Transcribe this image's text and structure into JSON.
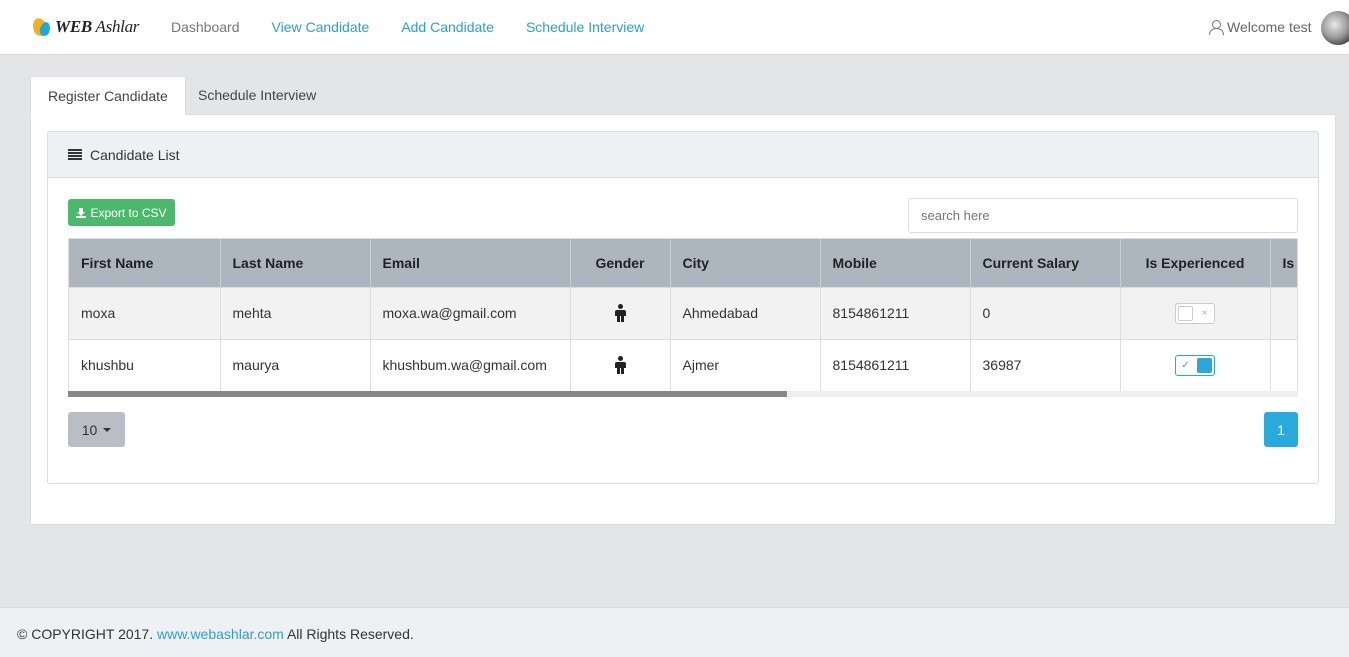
{
  "brand": {
    "logo_text_web": "WEB",
    "logo_text_rest": " Ashlar"
  },
  "nav": {
    "items": [
      {
        "label": "Dashboard"
      },
      {
        "label": "View Candidate"
      },
      {
        "label": "Add Candidate"
      },
      {
        "label": "Schedule Interview"
      }
    ]
  },
  "user": {
    "welcome": "Welcome test"
  },
  "tabs": [
    {
      "label": "Register Candidate"
    },
    {
      "label": "Schedule Interview"
    }
  ],
  "card": {
    "title": "Candidate List"
  },
  "toolbar": {
    "export_label": "Export to CSV",
    "search_placeholder": "search here"
  },
  "table": {
    "columns": [
      "First Name",
      "Last Name",
      "Email",
      "Gender",
      "City",
      "Mobile",
      "Current Salary",
      "Is Experienced",
      "Is"
    ],
    "rows": [
      {
        "first_name": "moxa",
        "last_name": "mehta",
        "email": "moxa.wa@gmail.com",
        "gender_icon": "male-icon",
        "city": "Ahmedabad",
        "mobile": "8154861211",
        "salary": "0",
        "is_experienced": false,
        "is_experienced_mark": "×"
      },
      {
        "first_name": "khushbu",
        "last_name": "maurya",
        "email": "khushbum.wa@gmail.com",
        "gender_icon": "male-icon",
        "city": "Ajmer",
        "mobile": "8154861211",
        "salary": "36987",
        "is_experienced": true,
        "is_experienced_mark": "✓"
      }
    ]
  },
  "pagination": {
    "page_size": "10",
    "current_page": "1"
  },
  "footer": {
    "copyright": "© COPYRIGHT 2017. ",
    "link": "www.webashlar.com",
    "rights": " All Rights Reserved."
  },
  "colors": {
    "accent": "#2aa9dd",
    "success": "#4cb86c",
    "header_bg": "#adb5be"
  }
}
